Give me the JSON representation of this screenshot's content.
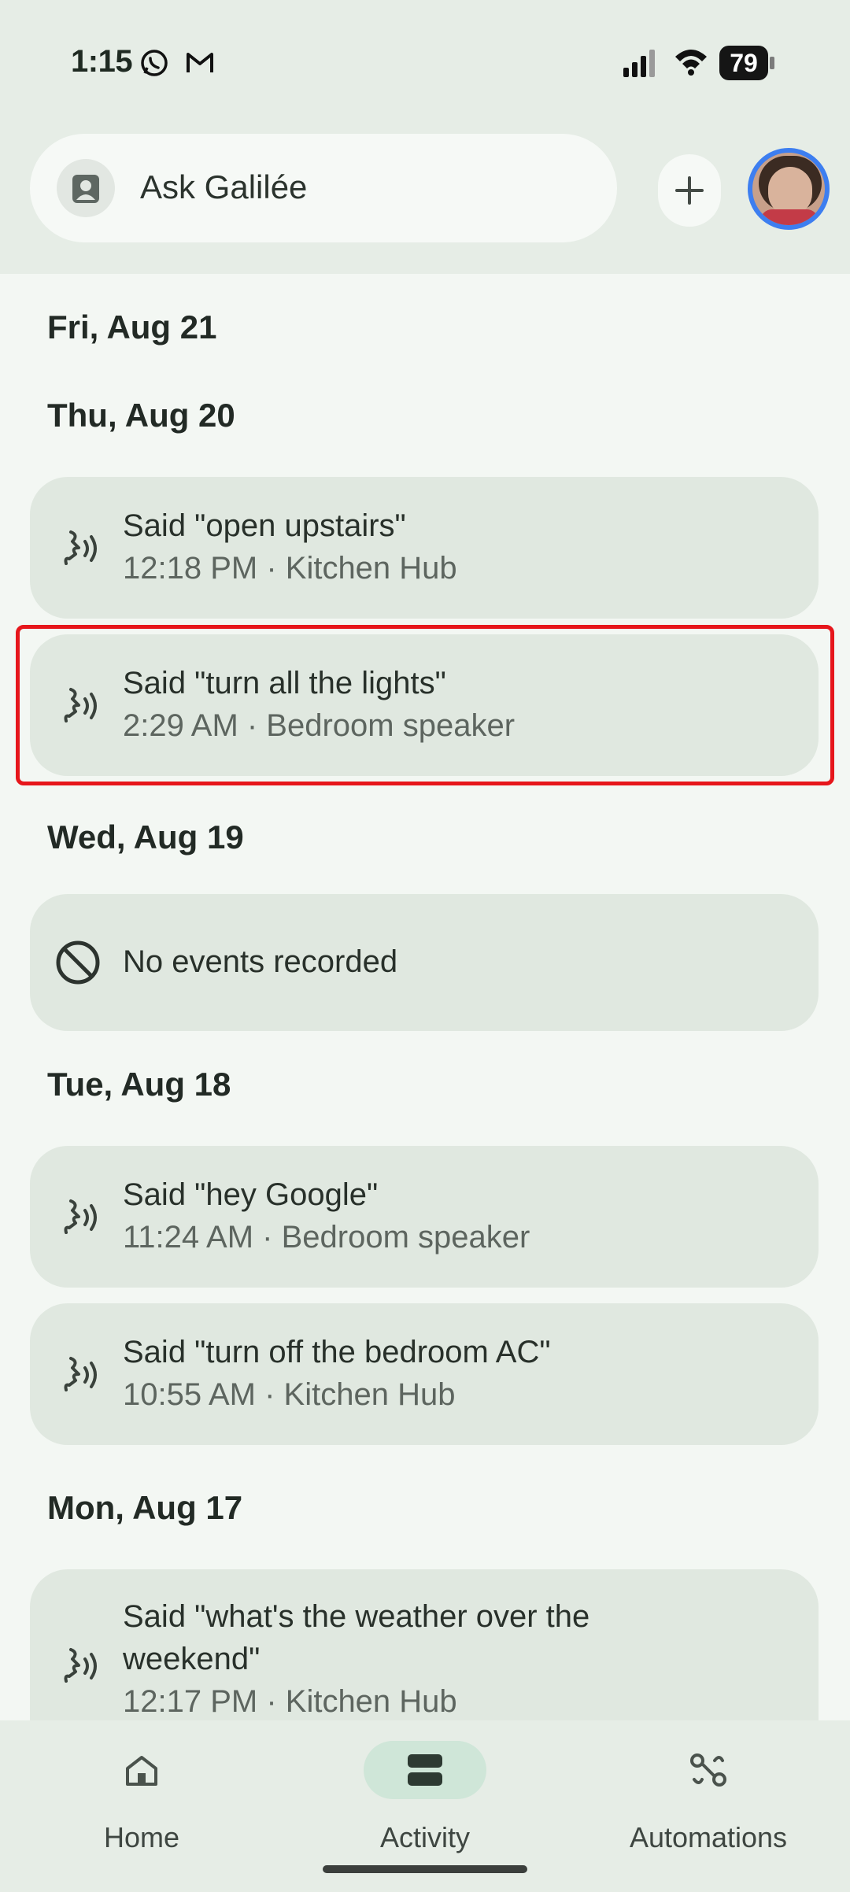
{
  "status_bar": {
    "time": "1:15",
    "battery": "79"
  },
  "header": {
    "search_label": "Ask Galilée"
  },
  "sections": [
    {
      "date": "Fri, Aug 21",
      "events": []
    },
    {
      "date": "Thu, Aug 20",
      "events": [
        {
          "title": "Said \"open upstairs\"",
          "sub": "12:18 PM · Kitchen Hub"
        },
        {
          "title": "Said \"turn all the lights\"",
          "sub": "2:29 AM · Bedroom speaker"
        }
      ]
    },
    {
      "date": "Wed, Aug 19",
      "events": [
        {
          "title": "No events recorded"
        }
      ]
    },
    {
      "date": "Tue, Aug 18",
      "events": [
        {
          "title": "Said \"hey Google\"",
          "sub": "11:24 AM · Bedroom speaker"
        },
        {
          "title": "Said \"turn off the bedroom AC\"",
          "sub": "10:55 AM · Kitchen Hub"
        }
      ]
    },
    {
      "date": "Mon, Aug 17",
      "events": [
        {
          "title_line1": "Said \"what's the weather over the",
          "title_line2": "weekend\"",
          "sub": "12:17 PM · Kitchen Hub"
        }
      ]
    }
  ],
  "bottom_nav": [
    {
      "label": "Home",
      "icon": "home-icon"
    },
    {
      "label": "Activity",
      "icon": "activity-icon",
      "active": true
    },
    {
      "label": "Automations",
      "icon": "automations-icon"
    }
  ],
  "colors": {
    "accent_highlight": "#e6161b",
    "card": "#e0e8e0",
    "active_nav": "#cfe6d8"
  }
}
